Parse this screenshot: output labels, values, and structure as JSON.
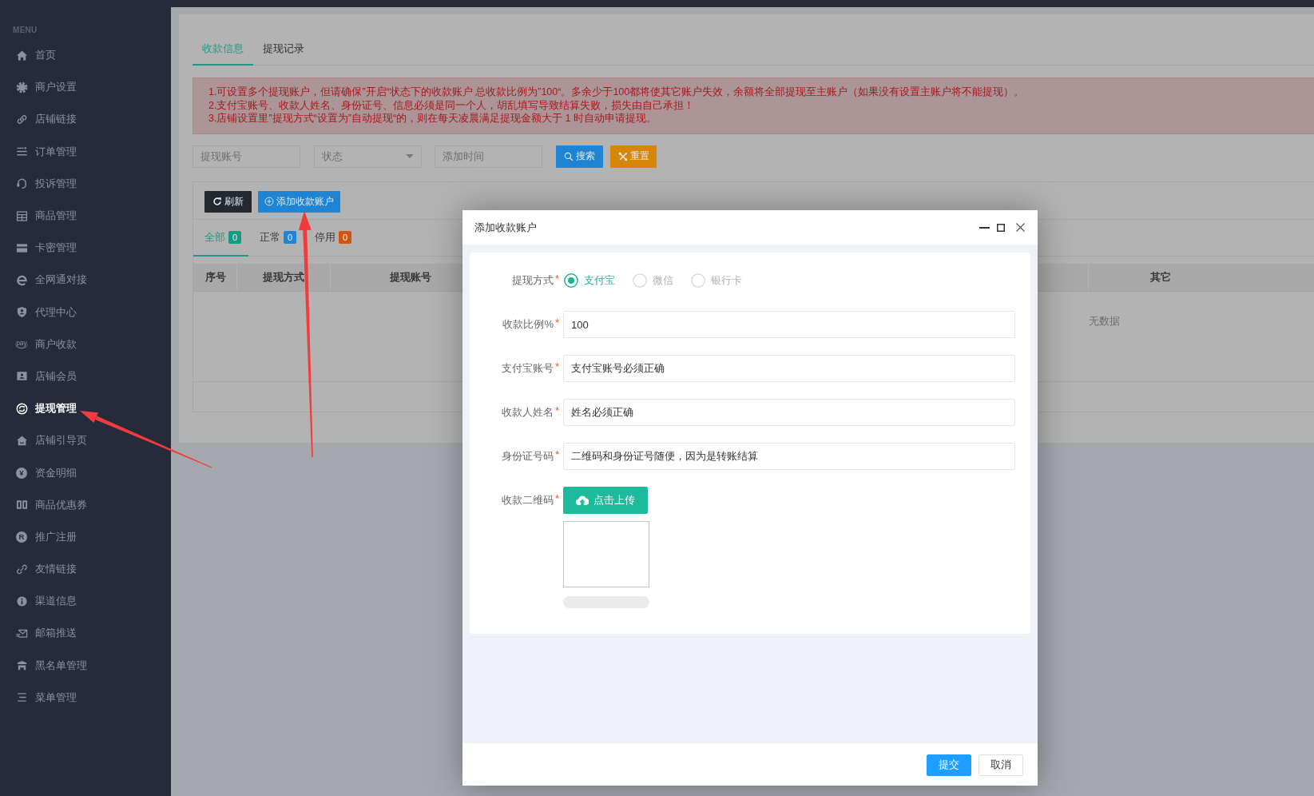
{
  "sidebar": {
    "heading": "MENU",
    "items": [
      {
        "label": "首页",
        "selected": false
      },
      {
        "label": "商户设置",
        "selected": false
      },
      {
        "label": "店铺链接",
        "selected": false
      },
      {
        "label": "订单管理",
        "selected": false
      },
      {
        "label": "投诉管理",
        "selected": false
      },
      {
        "label": "商品管理",
        "selected": false
      },
      {
        "label": "卡密管理",
        "selected": false
      },
      {
        "label": "全网通对接",
        "selected": false
      },
      {
        "label": "代理中心",
        "selected": false
      },
      {
        "label": "商户收款",
        "selected": false,
        "icon_text": "pay"
      },
      {
        "label": "店铺会员",
        "selected": false
      },
      {
        "label": "提现管理",
        "selected": true
      },
      {
        "label": "店铺引导页",
        "selected": false
      },
      {
        "label": "资金明细",
        "selected": false,
        "icon_text": "¥"
      },
      {
        "label": "商品优惠券",
        "selected": false
      },
      {
        "label": "推广注册",
        "selected": false,
        "icon_text": "R"
      },
      {
        "label": "友情链接",
        "selected": false
      },
      {
        "label": "渠道信息",
        "selected": false
      },
      {
        "label": "邮箱推送",
        "selected": false
      },
      {
        "label": "黑名单管理",
        "selected": false
      },
      {
        "label": "菜单管理",
        "selected": false
      }
    ]
  },
  "tabs": [
    {
      "label": "收款信息",
      "selected": true
    },
    {
      "label": "提现记录",
      "selected": false
    }
  ],
  "notice": [
    "1.可设置多个提现账户，但请确保”开启“状态下的收款账户 总收款比例为”100“。多余少于100都将使其它账户失效，余额将全部提现至主账户（如果没有设置主账户将不能提现）。",
    "2.支付宝账号、收款人姓名、身份证号、信息必须是同一个人，胡乱填写导致结算失败，损失由自己承担！",
    "3.店铺设置里”提现方式“设置为”自动提现“的，则在每天凌晨满足提现金额大于 1 时自动申请提现。"
  ],
  "filters": {
    "fields": [
      {
        "kind": "input",
        "placeholder": "提现账号"
      },
      {
        "kind": "select",
        "placeholder": "状态"
      },
      {
        "kind": "input",
        "placeholder": "添加时间"
      }
    ],
    "buttons": [
      {
        "kind": "search",
        "label": "搜索"
      },
      {
        "kind": "reset",
        "label": "重置"
      }
    ]
  },
  "toolbar": {
    "buttons": [
      {
        "kind": "refresh",
        "label": "刷新"
      },
      {
        "kind": "add",
        "label": "添加收款账户"
      }
    ]
  },
  "status_tabs": [
    {
      "label": "全部",
      "count": "0",
      "color": "#159a84",
      "selected": true
    },
    {
      "label": "正常",
      "count": "0",
      "color": "#1f84d4",
      "selected": false
    },
    {
      "label": "停用",
      "count": "0",
      "color": "#d5520f",
      "selected": false
    }
  ],
  "table": {
    "columns": [
      "序号",
      "提现方式",
      "提现账号",
      "其它"
    ],
    "empty_text": "无数据"
  },
  "dialog": {
    "title": "添加收款账户",
    "fields": [
      {
        "kind": "radio",
        "label": "提现方式",
        "mark": "*",
        "options": [
          {
            "label": "支付宝",
            "selected": true
          },
          {
            "label": "微信",
            "selected": false
          },
          {
            "label": "银行卡",
            "selected": false
          }
        ]
      },
      {
        "kind": "text",
        "label": "收款比例%",
        "mark": "*",
        "value": "100"
      },
      {
        "kind": "text",
        "label": "支付宝账号",
        "mark": "*",
        "value": "支付宝账号必须正确"
      },
      {
        "kind": "text",
        "label": "收款人姓名",
        "mark": "*",
        "value": "姓名必须正确"
      },
      {
        "kind": "text",
        "label": "身份证号码",
        "mark": "*",
        "value": "二维码和身份证号随便，因为是转账结算"
      },
      {
        "kind": "upload",
        "label": "收款二维码",
        "mark": "*",
        "button": "点击上传",
        "progress": {
          "level": 0
        }
      }
    ],
    "buttons": [
      {
        "kind": "primary",
        "label": "提交"
      },
      {
        "kind": "secondary",
        "label": "取消"
      }
    ]
  }
}
